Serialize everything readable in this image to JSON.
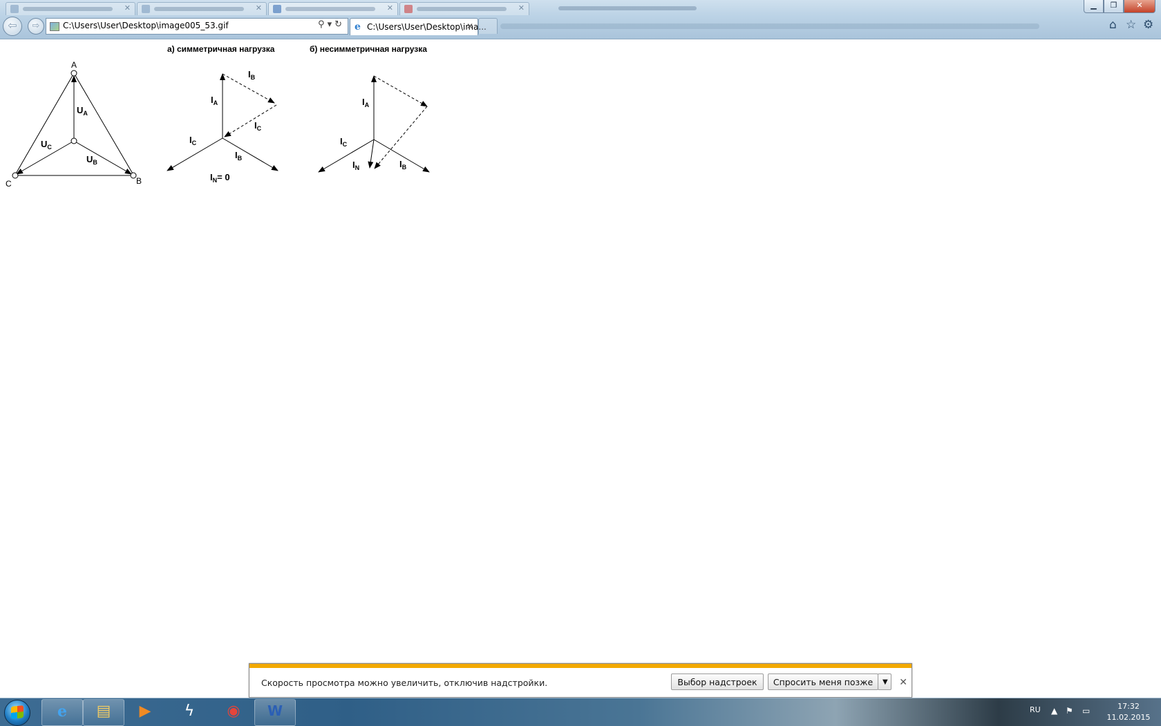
{
  "browser": {
    "address_url": "C:\\Users\\User\\Desktop\\image005_53.gif",
    "active_tab_title": "C:\\Users\\User\\Desktop\\ima...",
    "back_icon": "back-arrow-icon",
    "forward_icon": "forward-arrow-icon",
    "search_icon": "magnifier-icon",
    "refresh_icon": "refresh-icon",
    "home_icon": "home-icon",
    "favorites_icon": "star-icon",
    "tools_icon": "gear-icon"
  },
  "diagram": {
    "title_a": "а) симметричная нагрузка",
    "title_b": "б) несимметричная нагрузка",
    "star": {
      "vertex_a": "A",
      "vertex_b": "B",
      "vertex_c": "C",
      "u_a": "U",
      "u_a_sub": "A",
      "u_b": "U",
      "u_b_sub": "B",
      "u_c": "U",
      "u_c_sub": "C"
    },
    "sym": {
      "i_a": "I",
      "i_a_sub": "A",
      "i_b_top": "I",
      "i_b_top_sub": "B",
      "i_c_mid": "I",
      "i_c_mid_sub": "C",
      "i_c": "I",
      "i_c_sub": "C",
      "i_b": "I",
      "i_b_sub": "B",
      "i_n_eq": "I",
      "i_n_eq_sub": "N",
      "i_n_eq_rest": "= 0"
    },
    "asym": {
      "i_a": "I",
      "i_a_sub": "A",
      "i_c": "I",
      "i_c_sub": "C",
      "i_n": "I",
      "i_n_sub": "N",
      "i_b": "I",
      "i_b_sub": "B"
    }
  },
  "notification": {
    "message": "Скорость просмотра можно увеличить, отключив надстройки.",
    "choose_button": "Выбор надстроек",
    "later_button": "Спросить меня позже",
    "accent_color": "#f2a900"
  },
  "taskbar": {
    "language": "RU",
    "time": "17:32",
    "date": "11.02.2015"
  }
}
